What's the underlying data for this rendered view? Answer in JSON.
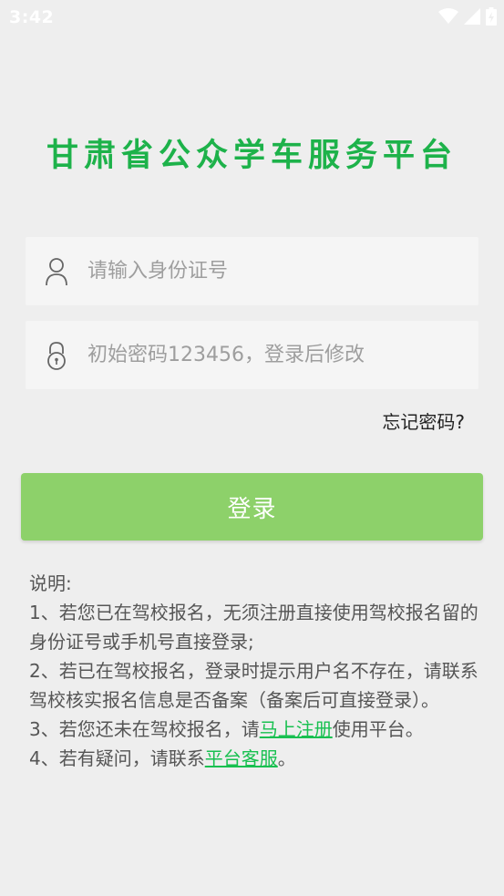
{
  "status_bar": {
    "time": "3:42",
    "icons": [
      "wifi-icon",
      "signal-icon",
      "battery-icon"
    ]
  },
  "app": {
    "title": "甘肃省公众学车服务平台",
    "accent_color": "#1db24a",
    "button_color": "#8dd16a",
    "link_color": "#18c050"
  },
  "form": {
    "id_placeholder": "请输入身份证号",
    "id_value": "",
    "password_placeholder": "初始密码123456，登录后修改",
    "password_value": "",
    "forgot_label": "忘记密码?",
    "login_label": "登录"
  },
  "notes": {
    "heading": "说明:",
    "item1": "1、若您已在驾校报名，无须注册直接使用驾校报名留的身份证号或手机号直接登录;",
    "item2": "2、若已在驾校报名，登录时提示用户名不存在，请联系驾校核实报名信息是否备案（备案后可直接登录）。",
    "item3_prefix": "3、若您还未在驾校报名，请",
    "item3_link": "马上注册",
    "item3_suffix": "使用平台。",
    "item4_prefix": "4、若有疑问，请联系",
    "item4_link": "平台客服",
    "item4_suffix": "。"
  }
}
